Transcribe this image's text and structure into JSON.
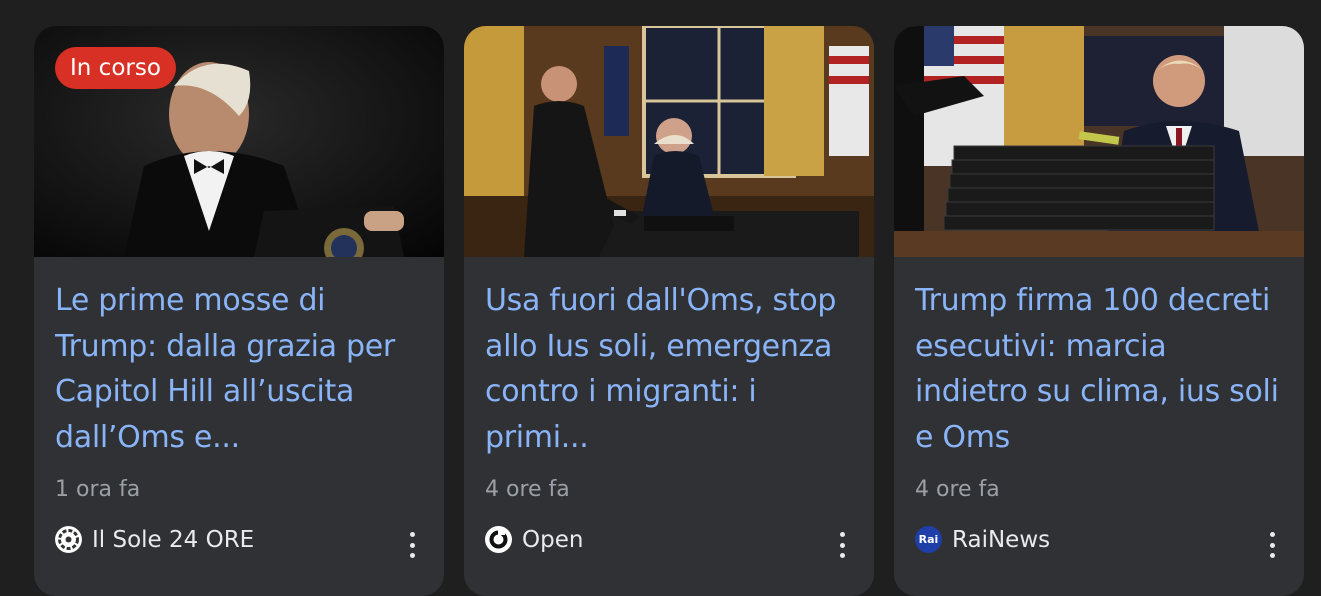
{
  "colors": {
    "background": "#1f1f1f",
    "card": "#303134",
    "title": "#8ab4f8",
    "badge": "#d93025",
    "meta": "#9aa0a6"
  },
  "cards": [
    {
      "badge": "In corso",
      "image": "trump-at-podium-photo",
      "title": "Le prime mosse di Trump: dalla grazia per Capitol Hill all’uscita dall’Oms e...",
      "time": "1 ora fa",
      "source": "Il Sole 24 ORE",
      "source_icon": "il-sole-24-ore-logo",
      "more_icon": "more-vert-icon"
    },
    {
      "image": "oval-office-signing-photo",
      "title": "Usa fuori dall'Oms, stop allo Ius soli, emergenza contro i migranti: i primi...",
      "time": "4 ore fa",
      "source": "Open",
      "source_icon": "open-logo",
      "more_icon": "more-vert-icon"
    },
    {
      "image": "trump-desk-folders-photo",
      "title": "Trump firma 100 decreti esecutivi: marcia indietro su clima, ius soli e Oms",
      "time": "4 ore fa",
      "source": "RaiNews",
      "source_icon": "rainews-logo",
      "source_logo_text": "Rai",
      "more_icon": "more-vert-icon"
    }
  ]
}
